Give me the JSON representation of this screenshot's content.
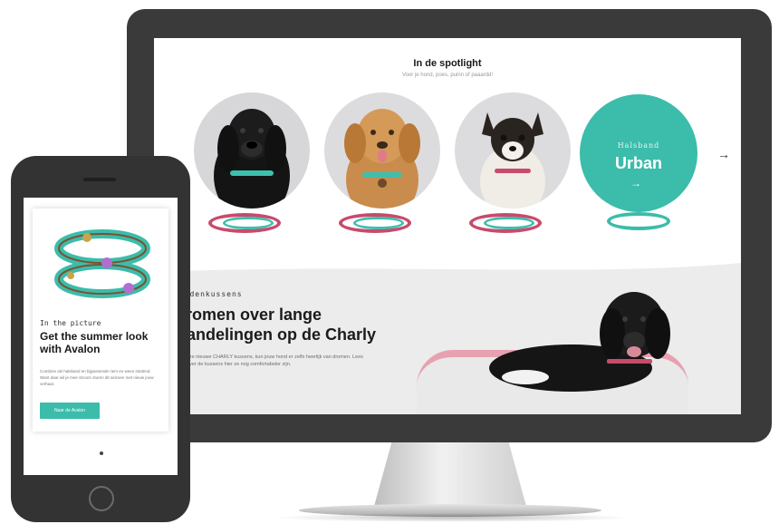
{
  "spotlight": {
    "title": "In de spotlight",
    "subtitle": "Voor je hond, poes, puinn of paaardd!"
  },
  "featured": {
    "small": "Halsband",
    "big": "Urban",
    "arrow": "→",
    "next_arrow": "→"
  },
  "promo": {
    "label": "Hondenkussens",
    "title": "Dromen over lange wandelingen op de Charly",
    "text": "Met onze nieuwe CHARLY kussens, kun jouw hond er zelfs heerlijk van dromen. Lees meer over de kussens hier ze nog comfortabeler zijn."
  },
  "phone": {
    "label": "In the picture",
    "title": "Get the summer look with Avalon",
    "text": "Combine als halsband en bijpassende riem en wees stralend. Want daar wil je mee stroom sturen dit seizoen met nieuw jouw verhaal.",
    "button": "Naar de Avalon"
  },
  "colors": {
    "teal": "#3cbcaa",
    "pink": "#c94a6a",
    "device_dark": "#3a3a3a"
  }
}
